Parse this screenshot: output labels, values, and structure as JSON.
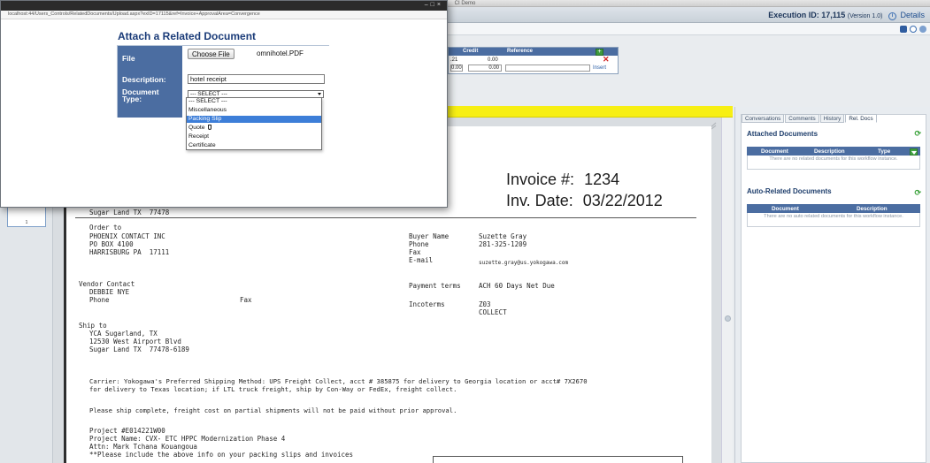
{
  "window": {
    "title": "CI Demo"
  },
  "header": {
    "execution_label": "Execution ID: 17,115",
    "version": "(Version 1.0)",
    "details_label": "Details"
  },
  "ledger": {
    "columns": [
      "Credit",
      "Reference"
    ],
    "row1_partial": ".21",
    "row1_credit": "0.00",
    "row2_partial": "0.00",
    "row2_credit": "0.00",
    "insert_label": "Insert"
  },
  "dialog": {
    "url": "localhost:44/Users_Controls/RelatedDocuments/Upload.aspx?exID=17115&ref=Invoice+ApprovalArea=Convergence",
    "title": "Attach a Related Document",
    "file_label": "File",
    "choose_button": "Choose File",
    "file_name": "omnihotel.PDF",
    "description_label": "Description:",
    "description_value": "hotel receipt",
    "doctype_label": "Document Type:",
    "select_value": "--- SELECT ---",
    "options": [
      "--- SELECT ---",
      "Miscellaneous",
      "Packing Slip",
      "Quote",
      "Receipt",
      "Certificate"
    ],
    "highlighted_option": "Packing Slip"
  },
  "invoice": {
    "number_label": "Invoice #:",
    "number": "1234",
    "date_label": "Inv. Date:",
    "date": "03/22/2012",
    "partial_addr": "Sugar Land TX  77478",
    "order_to_label": "Order to",
    "order_to": [
      "PHOENIX CONTACT INC",
      "PO BOX 4100",
      "HARRISBURG PA  17111"
    ],
    "buyer_labels": [
      "Buyer Name",
      "Phone",
      "Fax",
      "E-mail"
    ],
    "buyer_values": [
      "Suzette Gray",
      "281-325-1209",
      "",
      "suzette.gray@us.yokogawa.com"
    ],
    "vendor_contact_label": "Vendor Contact",
    "vendor_contact": "DEBBIE NYE",
    "phone_label": "Phone",
    "fax_label": "Fax",
    "payment_terms_label": "Payment terms",
    "payment_terms": "ACH 60 Days Net Due",
    "incoterms_label": "Incoterms",
    "incoterms": [
      "Z03",
      "COLLECT"
    ],
    "ship_to_label": "Ship to",
    "ship_to": [
      "YCA Sugarland, TX",
      "12530 West Airport Blvd",
      "Sugar Land TX  77478-6189"
    ],
    "carrier_note": [
      "Carrier: Yokogawa's Preferred Shipping Method: UPS Freight Collect, acct # 385875 for delivery to Georgia location or acct# 7X2670",
      "for delivery to Texas location; if LTL truck freight, ship by Con-Way or FedEx, freight collect."
    ],
    "ship_complete_note": "Please ship complete, freight cost on partial shipments will not be paid without prior approval.",
    "project_lines": [
      "Project #E014221W00",
      "Project Name: CVX- ETC HPPC Modernization Phase 4",
      "Attn: Mark Tchana Kouangoua",
      "**Please include the above info on your packing slips and invoices"
    ]
  },
  "thumbnail": {
    "page_number": "1"
  },
  "right_panel": {
    "tabs": [
      "Conversations",
      "Comments",
      "History",
      "Rel. Docs"
    ],
    "active_tab": "Rel. Docs",
    "attached_title": "Attached Documents",
    "attached_columns": [
      "Document",
      "Description",
      "Type"
    ],
    "attached_empty": "There are no related documents for this workflow instance.",
    "auto_title": "Auto-Related Documents",
    "auto_columns": [
      "Document",
      "Description"
    ],
    "auto_empty": "There are no auto related documents for this workflow instance."
  },
  "colors": {
    "header_blue": "#4b6da1",
    "highlight_yellow": "#f7ef13",
    "title_navy": "#1a3b78"
  }
}
